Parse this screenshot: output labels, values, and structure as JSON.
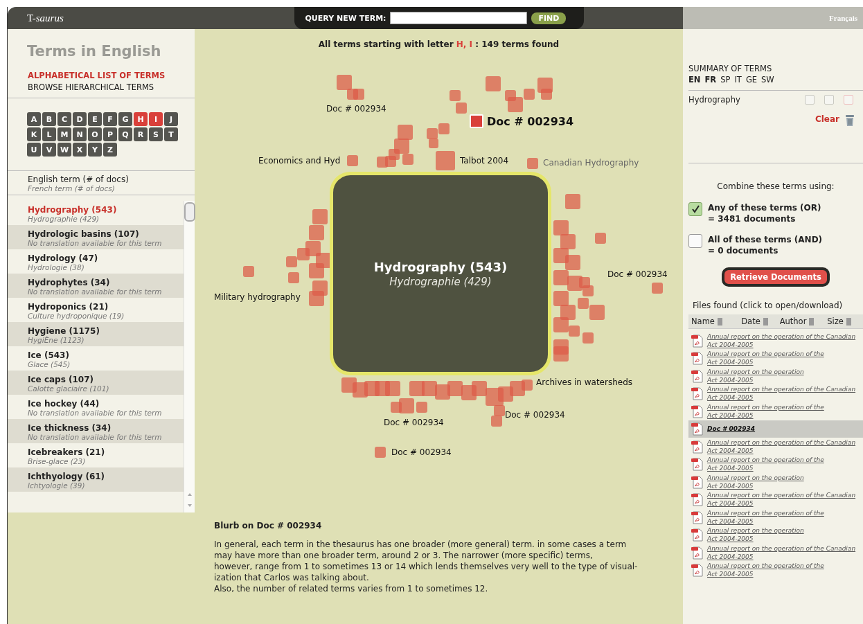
{
  "top_bar": {
    "logo": "T-*saurus*",
    "query_label": "QUERY NEW TERM:",
    "find_button": "FIND",
    "language_link": "Français"
  },
  "left_panel": {
    "title": "Terms in English",
    "views": [
      {
        "label": "ALPHABETICAL LIST OF TERMS",
        "selected": true
      },
      {
        "label": "BROWSE HIERARCHICAL TERMS",
        "selected": false
      }
    ],
    "letters": [
      {
        "label": "A",
        "selected": false
      },
      {
        "label": "B",
        "selected": false
      },
      {
        "label": "C",
        "selected": false
      },
      {
        "label": "D",
        "selected": false
      },
      {
        "label": "E",
        "selected": false
      },
      {
        "label": "F",
        "selected": false
      },
      {
        "label": "G",
        "selected": false
      },
      {
        "label": "H",
        "selected": true
      },
      {
        "label": "I",
        "selected": true
      },
      {
        "label": "J",
        "selected": false
      },
      {
        "label": "K",
        "selected": false
      },
      {
        "label": "L",
        "selected": false
      },
      {
        "label": "M",
        "selected": false
      },
      {
        "label": "N",
        "selected": false
      },
      {
        "label": "O",
        "selected": false
      },
      {
        "label": "P",
        "selected": false
      },
      {
        "label": "Q",
        "selected": false
      },
      {
        "label": "R",
        "selected": false
      },
      {
        "label": "S",
        "selected": false
      },
      {
        "label": "T",
        "selected": false
      },
      {
        "label": "U",
        "selected": false
      },
      {
        "label": "V",
        "selected": false
      },
      {
        "label": "W",
        "selected": false
      },
      {
        "label": "X",
        "selected": false
      },
      {
        "label": "Y",
        "selected": false
      },
      {
        "label": "Z",
        "selected": false
      }
    ],
    "legend": {
      "english": "English term (# of docs)",
      "french": "French term (# of docs)"
    },
    "terms": [
      {
        "english": "Hydrography (543)",
        "french": "Hydrographie (429)",
        "selected": true
      },
      {
        "english": "Hydrologic basins (107)",
        "french": "No translation available for this term",
        "selected": false
      },
      {
        "english": "Hydrology (47)",
        "french": "Hydrologie (38)",
        "selected": false
      },
      {
        "english": "Hydrophytes (34)",
        "french": "No translation available for this term",
        "selected": false
      },
      {
        "english": "Hydroponics (21)",
        "french": "Culture hydroponique (19)",
        "selected": false
      },
      {
        "english": "Hygiene (1175)",
        "french": "HygiÈne (1123)",
        "selected": false
      },
      {
        "english": "Ice (543)",
        "french": "Glace (545)",
        "selected": false
      },
      {
        "english": "Ice caps (107)",
        "french": "Calotte glaciaire (101)",
        "selected": false
      },
      {
        "english": "Ice hockey (44)",
        "french": "No translation available for this term",
        "selected": false
      },
      {
        "english": "Ice thickness (34)",
        "french": "No translation available for this term",
        "selected": false
      },
      {
        "english": "Icebreakers (21)",
        "french": "Brise-glace (23)",
        "selected": false
      },
      {
        "english": "Ichthyology (61)",
        "french": "Ichtyologie (39)",
        "selected": false
      }
    ]
  },
  "center": {
    "heading": "All terms starting with letter **H, I** : 149 terms found",
    "focus_term": {
      "english": "Hydrography (543)",
      "french": "Hydrographie (429)"
    },
    "labels": [
      {
        "text": "Doc # 002934",
        "selected": false,
        "dimmed": false
      },
      {
        "text": "Doc # 002934",
        "selected": true,
        "dimmed": false
      },
      {
        "text": "Economics and Hyd",
        "selected": false,
        "dimmed": false
      },
      {
        "text": "Talbot 2004",
        "selected": false,
        "dimmed": false
      },
      {
        "text": "Canadian Hydrography",
        "selected": false,
        "dimmed": true
      },
      {
        "text": "Military hydrography",
        "selected": false,
        "dimmed": false
      },
      {
        "text": "Doc # 002934",
        "selected": false,
        "dimmed": false
      },
      {
        "text": "Archives in watersheds",
        "selected": false,
        "dimmed": false
      },
      {
        "text": "Doc # 002934",
        "selected": false,
        "dimmed": false
      },
      {
        "text": "Doc # 002934",
        "selected": false,
        "dimmed": false
      },
      {
        "text": "Doc # 002934",
        "selected": false,
        "dimmed": false
      }
    ],
    "blurb": {
      "title": "Blurb on Doc # 002934",
      "lines": [
        "In general, each term in the thesaurus has one broader (more general) term. in some cases a term",
        "may have more than one broader term, around 2 or 3. The narrower (more specific) terms,",
        "however, range from 1 to sometimes 13 or 14 which lends themselves very well to the type of visual-",
        "ization that Carlos was talking about.",
        "Also, the number of related terms varies from 1 to sometimes 12."
      ]
    }
  },
  "right_panel": {
    "summary_title": "SUMMARY OF TERMS",
    "languages": [
      {
        "label": "EN",
        "active": true
      },
      {
        "label": "FR",
        "active": true
      },
      {
        "label": "SP",
        "active": false
      },
      {
        "label": "IT",
        "active": false
      },
      {
        "label": "GE",
        "active": false
      },
      {
        "label": "SW",
        "active": false
      }
    ],
    "summary_terms": [
      {
        "label": "Hydrography",
        "boxes": [
          {
            "color": "#c9c9c2"
          },
          {
            "color": "#c9c9c2"
          },
          {
            "color": "#eebcbc"
          }
        ]
      }
    ],
    "clear": "Clear",
    "combine_label": "Combine these terms using:",
    "options": [
      {
        "label": "Any of these terms (OR)",
        "count": "= 3481 documents",
        "checked": true
      },
      {
        "label": "All of these terms (AND)",
        "count": "= 0 documents",
        "checked": false
      }
    ],
    "retrieve_button": "Retrieve Documents",
    "files_label": "Files found (click to open/download)",
    "columns": [
      "Name",
      "Date",
      "Author",
      "Size"
    ],
    "files": [
      {
        "lines": [
          "Annual report on the operation of the Canadian",
          "Act 2004-2005"
        ],
        "selected": false
      },
      {
        "lines": [
          "Annual report on the operation of the",
          "Act 2004-2005"
        ],
        "selected": false
      },
      {
        "lines": [
          "Annual report on the operation",
          "Act 2004-2005"
        ],
        "selected": false
      },
      {
        "lines": [
          "Annual report on the operation of the Canadian",
          "Act 2004-2005"
        ],
        "selected": false
      },
      {
        "lines": [
          "Annual report on the operation of the",
          "Act 2004-2005"
        ],
        "selected": false
      },
      {
        "lines": [
          "Doc # 002934"
        ],
        "selected": true
      },
      {
        "lines": [
          "Annual report on the operation of the Canadian",
          "Act 2004-2005"
        ],
        "selected": false
      },
      {
        "lines": [
          "Annual report on the operation of the",
          "Act 2004-2005"
        ],
        "selected": false
      },
      {
        "lines": [
          "Annual report on the operation",
          "Act 2004-2005"
        ],
        "selected": false
      },
      {
        "lines": [
          "Annual report on the operation of the Canadian",
          "Act 2004-2005"
        ],
        "selected": false
      },
      {
        "lines": [
          "Annual report on the operation of the",
          "Act 2004-2005"
        ],
        "selected": false
      },
      {
        "lines": [
          "Annual report on the operation",
          "Act 2004-2005"
        ],
        "selected": false
      },
      {
        "lines": [
          "Annual report on the operation of the Canadian",
          "Act 2004-2005"
        ],
        "selected": false
      },
      {
        "lines": [
          "Annual report on the operation of the",
          "Act 2004-2005"
        ],
        "selected": false
      }
    ]
  }
}
